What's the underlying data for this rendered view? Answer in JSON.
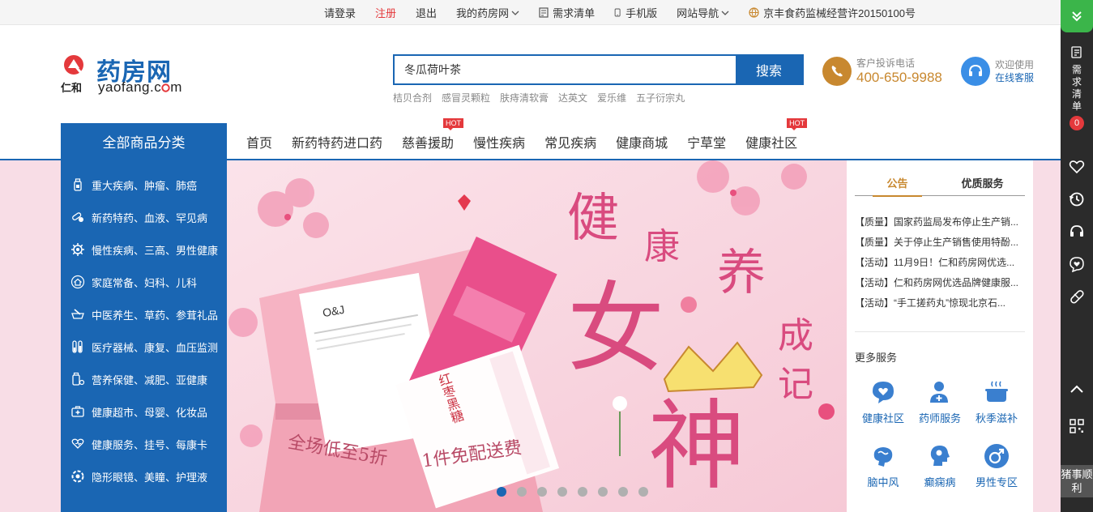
{
  "topbar": {
    "login": "请登录",
    "register": "注册",
    "logout": "退出",
    "my_pharmacy": "我的药房网",
    "demand_list": "需求清单",
    "mobile": "手机版",
    "site_nav": "网站导航",
    "license": "京丰食药监械经营许20150100号"
  },
  "logo": {
    "brand_cn": "药房网",
    "brand_en": "yaofang.c",
    "brand_en2": "m",
    "sub_cn": "仁和"
  },
  "search": {
    "value": "冬瓜荷叶茶",
    "button": "搜索",
    "hotwords": [
      "桔贝合剂",
      "感冒灵颗粒",
      "肤痔清软膏",
      "达英文",
      "爱乐维",
      "五子衍宗丸"
    ]
  },
  "contact": {
    "label": "客户投诉电话",
    "phone": "400-650-9988"
  },
  "service": {
    "label": "欢迎使用",
    "link": "在线客服"
  },
  "nav": {
    "all_label": "全部商品分类",
    "items": [
      {
        "label": "首页",
        "hot": ""
      },
      {
        "label": "新药特药进口药",
        "hot": ""
      },
      {
        "label": "慈善援助",
        "hot": "HOT"
      },
      {
        "label": "慢性疾病",
        "hot": ""
      },
      {
        "label": "常见疾病",
        "hot": ""
      },
      {
        "label": "健康商城",
        "hot": ""
      },
      {
        "label": "宁草堂",
        "hot": ""
      },
      {
        "label": "健康社区",
        "hot": "HOT"
      }
    ]
  },
  "categories": [
    {
      "label": "重大疾病、肿瘤、肺癌",
      "icon": "bottle-icon"
    },
    {
      "label": "新药特药、血液、罕见病",
      "icon": "pills-icon"
    },
    {
      "label": "慢性疾病、三高、男性健康",
      "icon": "gear-icon"
    },
    {
      "label": "家庭常备、妇科、儿科",
      "icon": "house-icon"
    },
    {
      "label": "中医养生、草药、参茸礼品",
      "icon": "mortar-icon"
    },
    {
      "label": "医疗器械、康复、血压监测",
      "icon": "testtube-icon"
    },
    {
      "label": "营养保健、减肥、亚健康",
      "icon": "supplement-icon"
    },
    {
      "label": "健康超市、母婴、化妆品",
      "icon": "medkit-icon"
    },
    {
      "label": "健康服务、挂号、每康卡",
      "icon": "heart-hand-icon"
    },
    {
      "label": "隐形眼镜、美瞳、护理液",
      "icon": "lens-icon"
    }
  ],
  "banner": {
    "headline_1": "健",
    "headline_2": "康",
    "headline_3": "养",
    "headline_4": "成",
    "headline_5": "记",
    "big_1": "女",
    "big_2": "神",
    "box_text_1": "全场低至5折",
    "box_text_2": "1件免配送费",
    "product_brand": "O&J",
    "product_name": "红枣黑糖",
    "slides": 8,
    "active_slide": 1
  },
  "right_panel": {
    "tab_active": "公告",
    "tab_other": "优质服务",
    "notices": [
      "【质量】国家药监局发布停止生产销...",
      "【质量】关于停止生产销售使用特酚...",
      "【活动】11月9日！仁和药房网优选...",
      "【活动】仁和药房网优选品牌健康服...",
      "【活动】“手工搓药丸”惊现北京石..."
    ],
    "more_title": "更多服务",
    "services": [
      {
        "label": "健康社区",
        "icon": "chat-heart-icon"
      },
      {
        "label": "药师服务",
        "icon": "doctor-icon"
      },
      {
        "label": "秋季滋补",
        "icon": "pot-icon"
      },
      {
        "label": "脑中风",
        "icon": "brain-icon"
      },
      {
        "label": "癫痫病",
        "icon": "head-icon"
      },
      {
        "label": "男性专区",
        "icon": "male-icon"
      }
    ]
  },
  "sidebar": {
    "demand": "需求清单",
    "badge": "0",
    "bottom": "猪事顺利"
  },
  "colors": {
    "brand_blue": "#1a66b3",
    "accent_red": "#e4393c",
    "gold": "#c8882f",
    "sidebar": "#2b2b2b"
  }
}
